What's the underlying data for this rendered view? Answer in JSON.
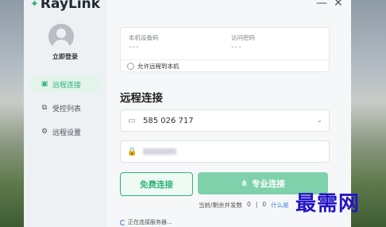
{
  "app": {
    "name": "RayLink"
  },
  "window": {
    "minimize": "—",
    "close": "✕"
  },
  "sidebar": {
    "login_label": "立即登录",
    "items": [
      {
        "label": "远程连接",
        "icon": "monitor-icon",
        "active": true
      },
      {
        "label": "受控列表",
        "icon": "device-list-icon",
        "active": false
      },
      {
        "label": "远程设置",
        "icon": "settings-icon",
        "active": false
      }
    ]
  },
  "device_card": {
    "device_code_label": "本机设备码",
    "device_code_value": "---",
    "access_password_label": "访问密码",
    "access_password_value": "---",
    "allow_remote_label": "允许远程到本机"
  },
  "main": {
    "title": "远程连接",
    "device_input_value": "585 026 717",
    "password_input_value": ""
  },
  "buttons": {
    "free_connect": "免费连接",
    "pro_connect": "专业连接"
  },
  "status_bar": {
    "concurrency_label": "当前/剩余并发数",
    "current": "0",
    "remaining": "0",
    "link_text": "什么是"
  },
  "connection_status": "正在连接服务器...",
  "watermark": "最需网",
  "colors": {
    "accent": "#2fb37a",
    "link": "#3d7be0",
    "watermark": "#2414c4"
  }
}
